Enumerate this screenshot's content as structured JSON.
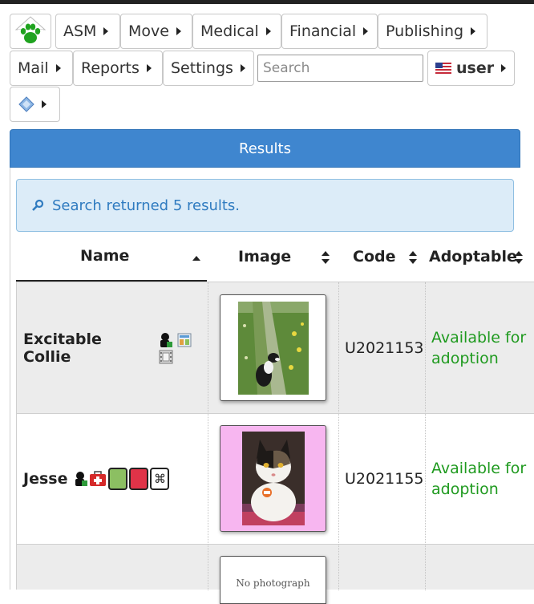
{
  "menu": {
    "items": [
      {
        "label": "ASM"
      },
      {
        "label": "Move"
      },
      {
        "label": "Medical"
      },
      {
        "label": "Financial"
      },
      {
        "label": "Publishing"
      },
      {
        "label": "Mail"
      },
      {
        "label": "Reports"
      },
      {
        "label": "Settings"
      }
    ],
    "search_placeholder": "Search",
    "user_label": "user",
    "logo_icon": "paw-icon",
    "extra_icon": "diamond-icon"
  },
  "results": {
    "header": "Results",
    "message": "Search returned 5 results.",
    "columns": [
      "Name",
      "Image",
      "Code",
      "Adoptable"
    ],
    "rows": [
      {
        "name": "Excitable Collie",
        "image": "collie-photo",
        "code": "U2021153",
        "adoptable": "Available for adoption",
        "icons": [
          "owner-icon",
          "media-icon",
          "film-icon"
        ]
      },
      {
        "name": "Jesse",
        "image": "cat-photo",
        "code": "U2021155",
        "adoptable": "Available for adoption",
        "icons": [
          "owner-icon",
          "medical-icon",
          "green-flag",
          "red-flag",
          "command-flag"
        ],
        "flags": {
          "green": "#8cbf62",
          "red": "#e03348",
          "command": "⌘"
        }
      },
      {
        "image_text": "No photograph"
      }
    ]
  },
  "colors": {
    "accent": "#3f86cf",
    "info_bg": "#dcecf8",
    "adoptable": "#1f9a1f",
    "logo_green": "#1fa31f"
  }
}
